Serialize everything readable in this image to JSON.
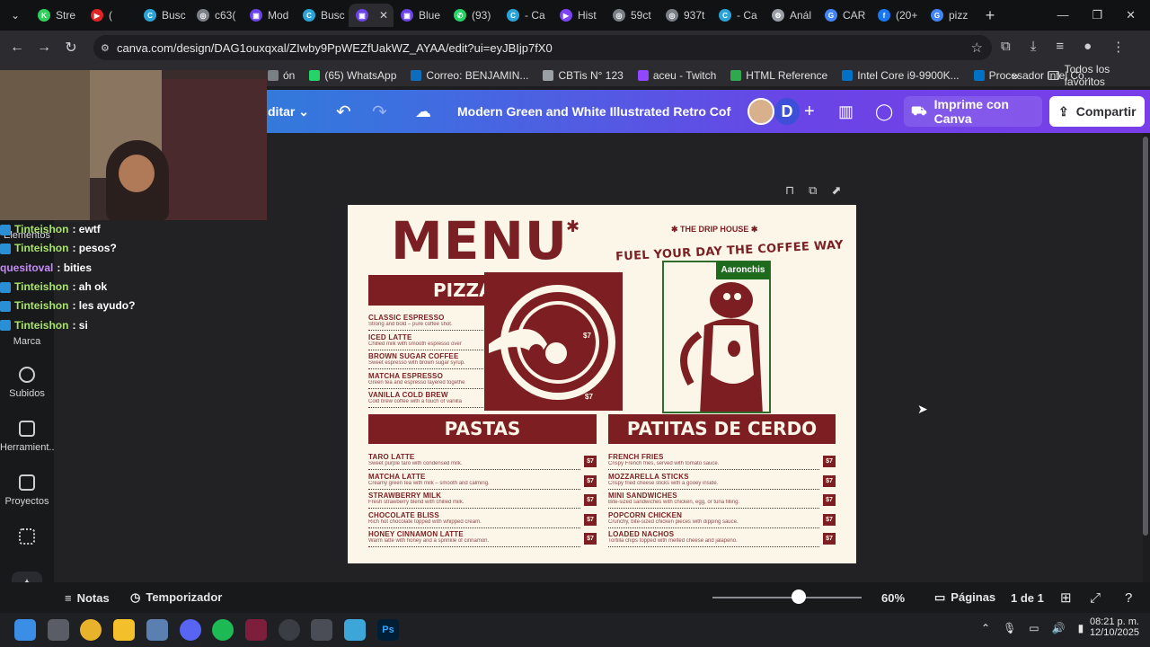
{
  "browser": {
    "tabs": [
      {
        "label": "Stre",
        "color": "#2fd05b",
        "glyph": "K"
      },
      {
        "label": "(",
        "color": "#e02424",
        "glyph": "▶"
      },
      {
        "label": "Busc",
        "color": "#2aa4d8",
        "glyph": "C"
      },
      {
        "label": "c63(",
        "color": "#7b7f86",
        "glyph": "◎"
      },
      {
        "label": "Mod",
        "color": "#6a44e6",
        "glyph": "▣"
      },
      {
        "label": "Busc",
        "color": "#2aa4d8",
        "glyph": "C"
      },
      {
        "label": "",
        "color": "#6a44e6",
        "glyph": "▣"
      },
      {
        "label": "Blue",
        "color": "#6a44e6",
        "glyph": "▣"
      },
      {
        "label": "(93)",
        "color": "#25d366",
        "glyph": "✆"
      },
      {
        "label": "- Ca",
        "color": "#2aa4d8",
        "glyph": "C"
      },
      {
        "label": "Hist",
        "color": "#7b42f6",
        "glyph": "▶"
      },
      {
        "label": "59ct",
        "color": "#7b7f86",
        "glyph": "◎"
      },
      {
        "label": "937t",
        "color": "#7b7f86",
        "glyph": "◎"
      },
      {
        "label": "- Ca",
        "color": "#2aa4d8",
        "glyph": "C"
      },
      {
        "label": "Anál",
        "color": "#9aa0a6",
        "glyph": "⚙"
      },
      {
        "label": "CAR",
        "color": "#4285f4",
        "glyph": "G"
      },
      {
        "label": "(20+",
        "color": "#1877f2",
        "glyph": "f"
      },
      {
        "label": "pizz",
        "color": "#4285f4",
        "glyph": "G"
      }
    ],
    "url": "canva.com/design/DAG1ouxqxal/ZIwby9PpWEZfUakWZ_AYAA/edit?ui=eyJBIjp7fX0",
    "bookmarks": [
      {
        "label": "ón",
        "color": "#7b7f86"
      },
      {
        "label": "(65) WhatsApp",
        "color": "#25d366"
      },
      {
        "label": "Correo: BENJAMIN...",
        "color": "#0f6cbd"
      },
      {
        "label": "CBTis N° 123",
        "color": "#9aa0a6"
      },
      {
        "label": "aceu - Twitch",
        "color": "#9146ff"
      },
      {
        "label": "HTML Reference",
        "color": "#2fa84f"
      },
      {
        "label": "Intel Core i9-9900K...",
        "color": "#0071c5"
      },
      {
        "label": "Procesador Intel Co...",
        "color": "#0071c5"
      }
    ],
    "all_bookmarks": "Todos los favoritos"
  },
  "canva": {
    "edit_label": "ditar",
    "doc_title": "Modern Green and White Illustrated Retro Coffee M...",
    "avatar_letter": "D",
    "print_label": "Imprime con Canva",
    "share_label": "Compartir",
    "left_panel": [
      {
        "label": "Elementos"
      },
      {
        "label": "Marca"
      },
      {
        "label": "Subidos"
      },
      {
        "label": "Herramient..."
      },
      {
        "label": "Proyectos"
      }
    ],
    "bottom": {
      "notes": "Notas",
      "timer": "Temporizador",
      "zoom": "60%",
      "zoom_fraction": 0.58,
      "pages_label": "Páginas",
      "page_count": "1 de 1"
    }
  },
  "chat": [
    {
      "user": "Tinteishon",
      "msg": ": ewtf",
      "color": "#a9e36b",
      "badge": true
    },
    {
      "user": "Tinteishon",
      "msg": ": pesos?",
      "color": "#a9e36b",
      "badge": true
    },
    {
      "user": "quesitoval",
      "msg": ": bities",
      "color": "#c58cf7",
      "badge": false
    },
    {
      "user": "Tinteishon",
      "msg": ": ah ok",
      "color": "#a9e36b",
      "badge": true
    },
    {
      "user": "Tinteishon",
      "msg": ": les ayudo?",
      "color": "#a9e36b",
      "badge": true
    },
    {
      "user": "Tinteishon",
      "msg": ": si",
      "color": "#a9e36b",
      "badge": true
    }
  ],
  "menu": {
    "title": "MENU",
    "brand": "THE DRIP HOUSE",
    "tagline": "FUEL YOUR DAY THE COFFEE WAY",
    "name_tag": "Aaronchis",
    "section1": "PIZZA BITES",
    "section2": "PASTAS",
    "section3": "PATITAS DE CERDO",
    "price": "$7",
    "list1": [
      {
        "name": "CLASSIC ESPRESSO",
        "desc": "Strong and bold – pure coffee shot."
      },
      {
        "name": "ICED LATTE",
        "desc": "Chilled milk with smooth espresso over"
      },
      {
        "name": "BROWN SUGAR COFFEE",
        "desc": "Sweet espresso with brown sugar syrup."
      },
      {
        "name": "MATCHA ESPRESSO",
        "desc": "Green tea and espresso layered togethe"
      },
      {
        "name": "VANILLA COLD BREW",
        "desc": "Cold brew coffee with a touch of vanilla"
      }
    ],
    "list2": [
      {
        "name": "TARO LATTE",
        "desc": "Sweet purple taro with condensed milk."
      },
      {
        "name": "MATCHA LATTE",
        "desc": "Creamy green tea with milk – smooth and calming."
      },
      {
        "name": "STRAWBERRY MILK",
        "desc": "Fresh strawberry blend with chilled milk."
      },
      {
        "name": "CHOCOLATE BLISS",
        "desc": "Rich hot chocolate topped with whipped cream."
      },
      {
        "name": "HONEY CINNAMON LATTE",
        "desc": "Warm latte with honey and a sprinkle of cinnamon."
      }
    ],
    "list3": [
      {
        "name": "FRENCH FRIES",
        "desc": "Crispy French fries, served with tomato sauce."
      },
      {
        "name": "MOZZARELLA STICKS",
        "desc": "Crispy fried cheese sticks with a gooey inside."
      },
      {
        "name": "MINI SANDWICHES",
        "desc": "Bite-sized sandwiches with chicken, egg, or tuna filling."
      },
      {
        "name": "POPCORN CHICKEN",
        "desc": "Crunchy, bite-sized chicken pieces with dipping sauce."
      },
      {
        "name": "LOADED NACHOS",
        "desc": "Tortilla chips topped with melted cheese and jalapeño."
      }
    ]
  },
  "taskbar": {
    "time": "08:21 p. m.",
    "date": "12/10/2025"
  }
}
